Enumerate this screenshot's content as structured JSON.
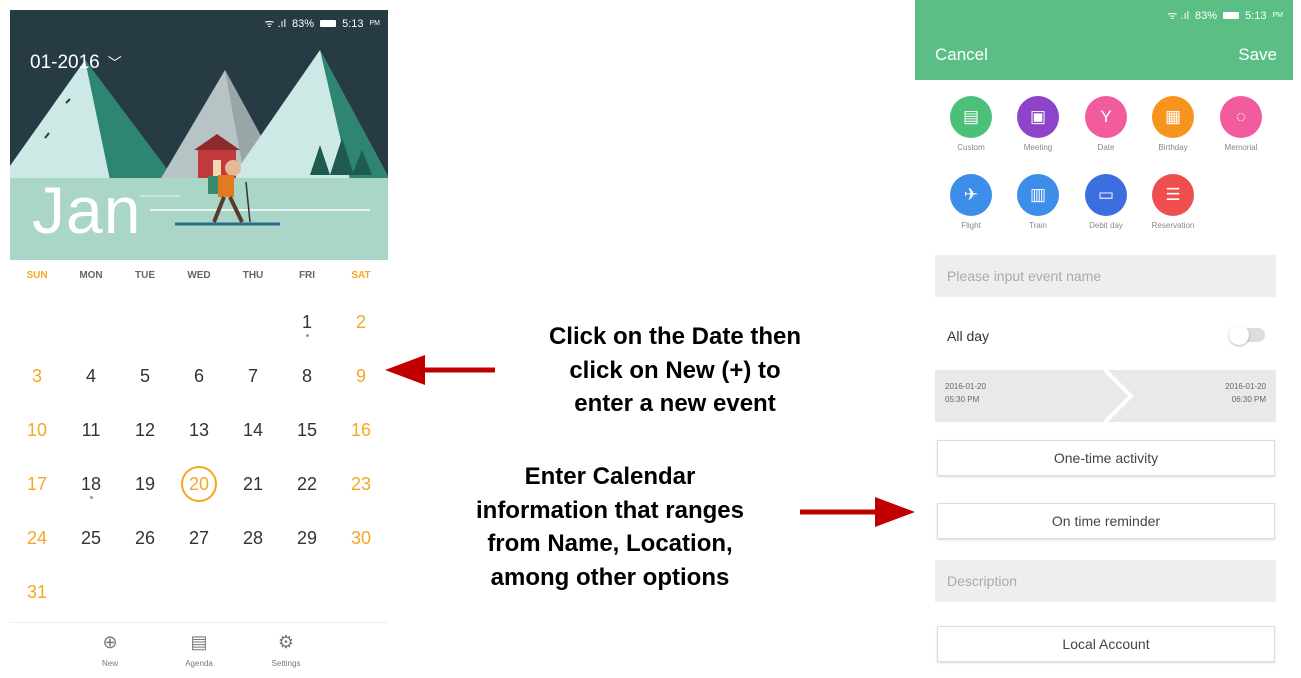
{
  "left_phone": {
    "status": {
      "signal": "ᯤ .ıl",
      "battery": "83%",
      "time": "5:13",
      "ampm": "PM"
    },
    "month_selector": "01-2016",
    "month_name": "Jan",
    "weekdays": [
      "SUN",
      "MON",
      "TUE",
      "WED",
      "THU",
      "FRI",
      "SAT"
    ],
    "weeks": [
      [
        "",
        "",
        "",
        "",
        "",
        "1",
        "2"
      ],
      [
        "3",
        "4",
        "5",
        "6",
        "7",
        "8",
        "9"
      ],
      [
        "10",
        "11",
        "12",
        "13",
        "14",
        "15",
        "16"
      ],
      [
        "17",
        "18",
        "19",
        "20",
        "21",
        "22",
        "23"
      ],
      [
        "24",
        "25",
        "26",
        "27",
        "28",
        "29",
        "30"
      ],
      [
        "31",
        "",
        "",
        "",
        "",
        "",
        ""
      ]
    ],
    "today": "20",
    "bottom_nav": [
      {
        "label": "New",
        "icon": "plus-circle-icon"
      },
      {
        "label": "Agenda",
        "icon": "agenda-icon"
      },
      {
        "label": "Settings",
        "icon": "gear-icon"
      }
    ]
  },
  "annotations": {
    "note1": [
      "Click on the Date then",
      "click on New (+) to",
      "enter a new event"
    ],
    "note2": [
      "Enter Calendar",
      "information that ranges",
      "from Name, Location,",
      "among other options"
    ],
    "arrow_color": "#c00000"
  },
  "right_phone": {
    "status": {
      "signal": "ᯤ .ıl",
      "battery": "83%",
      "time": "5:13",
      "ampm": "PM"
    },
    "cancel": "Cancel",
    "save": "Save",
    "categories": [
      {
        "label": "Custom",
        "color": "#4cbf7a",
        "icon": "list-icon"
      },
      {
        "label": "Meeting",
        "color": "#8e44c9",
        "icon": "meeting-icon"
      },
      {
        "label": "Date",
        "color": "#f25c9e",
        "icon": "cocktail-icon"
      },
      {
        "label": "Birthday",
        "color": "#f7941d",
        "icon": "cake-icon"
      },
      {
        "label": "Memorial",
        "color": "#f25c9e",
        "icon": "memorial-icon"
      },
      {
        "label": "Flight",
        "color": "#3c8ee8",
        "icon": "plane-icon"
      },
      {
        "label": "Train",
        "color": "#3c8ee8",
        "icon": "train-icon"
      },
      {
        "label": "Debit day",
        "color": "#3c6ee0",
        "icon": "card-icon"
      },
      {
        "label": "Reservation",
        "color": "#ee4e4e",
        "icon": "reservation-icon"
      }
    ],
    "event_name_placeholder": "Please input event name",
    "all_day": "All day",
    "start_date": "2016-01-20",
    "start_time": "05:30 PM",
    "end_date": "2016-01-20",
    "end_time": "06:30 PM",
    "repeat": "One-time activity",
    "reminder": "On time reminder",
    "description_placeholder": "Description",
    "account": "Local Account"
  }
}
